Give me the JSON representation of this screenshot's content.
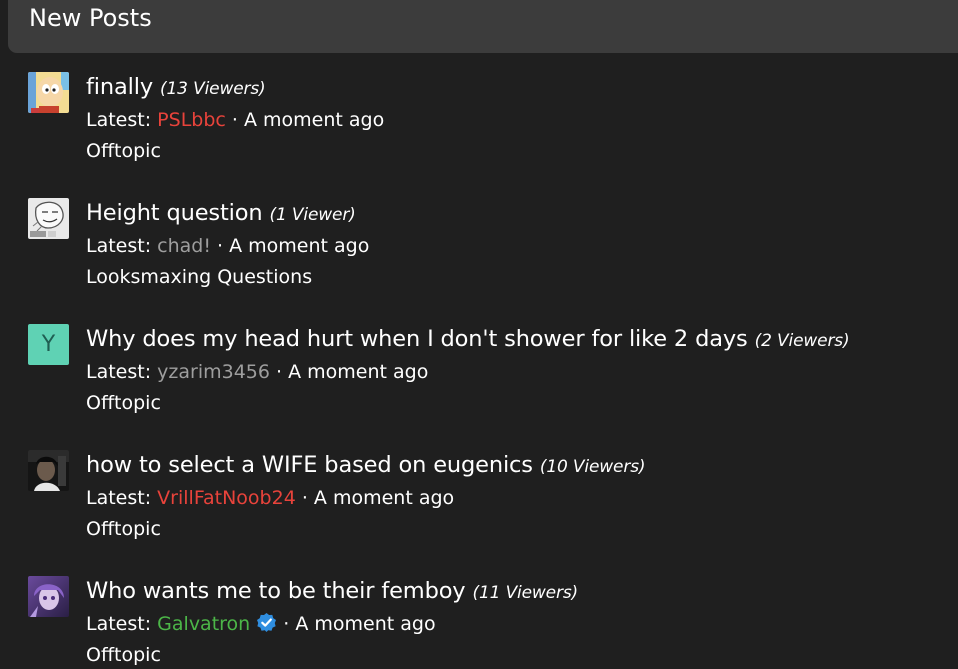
{
  "header": {
    "title": "New Posts"
  },
  "latest_label": "Latest: ",
  "separator": " · ",
  "posts": [
    {
      "title": "finally",
      "viewers": "(13 Viewers)",
      "user": "PSLbbc",
      "user_color": "#e8433b",
      "time": "A moment ago",
      "forum": "Offtopic",
      "avatar_icon": "cartoon-baby-avatar"
    },
    {
      "title": "Height question",
      "viewers": "(1 Viewer)",
      "user": "chad!",
      "user_color": "#9e9e9e",
      "time": "A moment ago",
      "forum": "Looksmaxing Questions",
      "avatar_icon": "sketch-drawing-avatar"
    },
    {
      "title": "Why does my head hurt when I don't shower for like 2 days",
      "viewers": "(2 Viewers)",
      "user": "yzarim3456",
      "user_color": "#9e9e9e",
      "time": "A moment ago",
      "forum": "Offtopic",
      "avatar_letter": "Y",
      "avatar_color": "#5fd2b4"
    },
    {
      "title": "how to select a WIFE based on eugenics",
      "viewers": "(10 Viewers)",
      "user": "VrillFatNoob24",
      "user_color": "#e8433b",
      "time": "A moment ago",
      "forum": "Offtopic",
      "avatar_icon": "dark-photo-avatar"
    },
    {
      "title": "Who wants me to be their femboy",
      "viewers": "(11 Viewers)",
      "user": "Galvatron",
      "user_color": "#4cb648",
      "verified": true,
      "time": "A moment ago",
      "forum": "Offtopic",
      "avatar_icon": "purple-anime-avatar"
    }
  ]
}
